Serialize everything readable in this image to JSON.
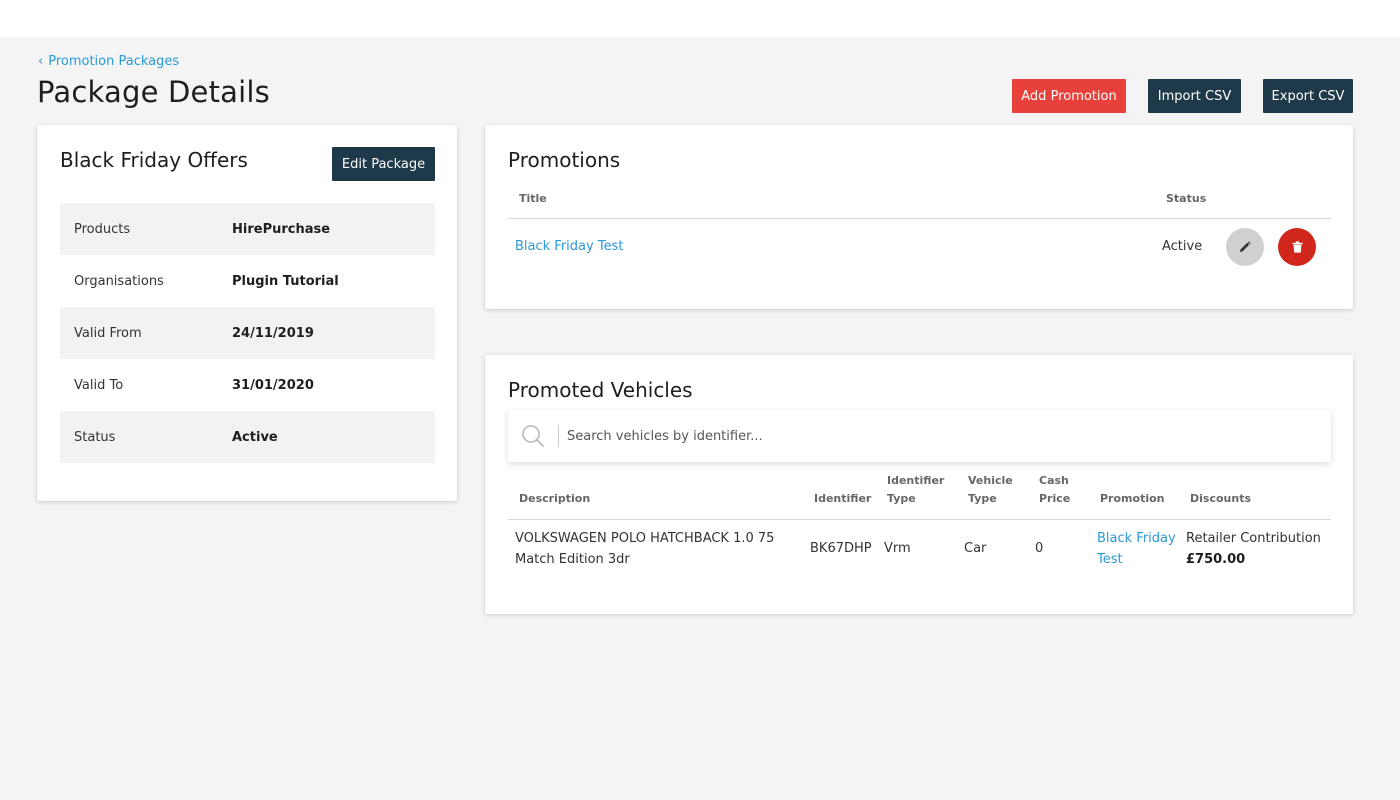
{
  "breadcrumb": {
    "label": "Promotion Packages"
  },
  "page": {
    "title": "Package Details"
  },
  "actions": {
    "add_promotion": "Add Promotion",
    "import_csv": "Import CSV",
    "export_csv": "Export CSV"
  },
  "package": {
    "title": "Black Friday Offers",
    "edit_label": "Edit Package",
    "details": [
      {
        "key": "Products",
        "value": "HirePurchase"
      },
      {
        "key": "Organisations",
        "value": "Plugin Tutorial"
      },
      {
        "key": "Valid From",
        "value": "24/11/2019"
      },
      {
        "key": "Valid To",
        "value": "31/01/2020"
      },
      {
        "key": "Status",
        "value": "Active"
      }
    ]
  },
  "promotions": {
    "title": "Promotions",
    "columns": {
      "title": "Title",
      "status": "Status"
    },
    "rows": [
      {
        "title": "Black Friday Test",
        "status": "Active"
      }
    ]
  },
  "vehicles": {
    "title": "Promoted Vehicles",
    "search_placeholder": "Search vehicles by identifier...",
    "columns": {
      "description": "Description",
      "identifier": "Identifier",
      "identifier_type_1": "Identifier",
      "identifier_type_2": "Type",
      "vehicle_type_1": "Vehicle",
      "vehicle_type_2": "Type",
      "cash_price_1": "Cash",
      "cash_price_2": "Price",
      "promotion": "Promotion",
      "discounts": "Discounts"
    },
    "rows": [
      {
        "description_1": "VOLKSWAGEN POLO HATCHBACK 1.0 75",
        "description_2": "Match Edition 3dr",
        "identifier": "BK67DHP",
        "identifier_type": "Vrm",
        "vehicle_type": "Car",
        "cash_price": "0",
        "promotion_1": "Black Friday",
        "promotion_2": "Test",
        "discount_label": "Retailer Contribution",
        "discount_value": "£750.00"
      }
    ]
  },
  "colors": {
    "link": "#2a9ad6",
    "primary_dark": "#1e3a4a",
    "danger": "#e8403a",
    "delete": "#d0261c",
    "background": "#f4f4f4"
  },
  "icons": {
    "breadcrumb": "chevron-left-icon",
    "edit": "pencil-icon",
    "delete": "trash-icon",
    "search": "search-icon"
  }
}
